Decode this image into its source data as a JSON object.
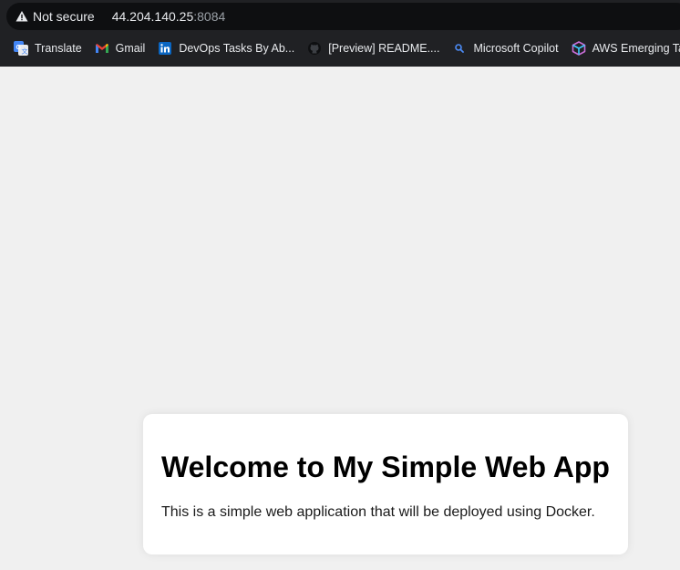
{
  "browser": {
    "security_label": "Not secure",
    "url_host": "44.204.140.25",
    "url_port": ":8084",
    "bookmarks": [
      {
        "label": "Translate",
        "icon": "google-translate-icon"
      },
      {
        "label": "Gmail",
        "icon": "gmail-icon"
      },
      {
        "label": "DevOps Tasks By Ab...",
        "icon": "linkedin-icon"
      },
      {
        "label": "[Preview] README....",
        "icon": "github-icon"
      },
      {
        "label": "Microsoft Copilot",
        "icon": "search-icon"
      },
      {
        "label": "AWS Emerging Tale...",
        "icon": "cube-icon"
      }
    ]
  },
  "page": {
    "heading": "Welcome to My Simple Web App",
    "description": "This is a simple web application that will be deployed using Docker."
  },
  "colors": {
    "page_background": "#f0f0f0",
    "card_background": "#ffffff",
    "chrome_background": "#202124"
  }
}
